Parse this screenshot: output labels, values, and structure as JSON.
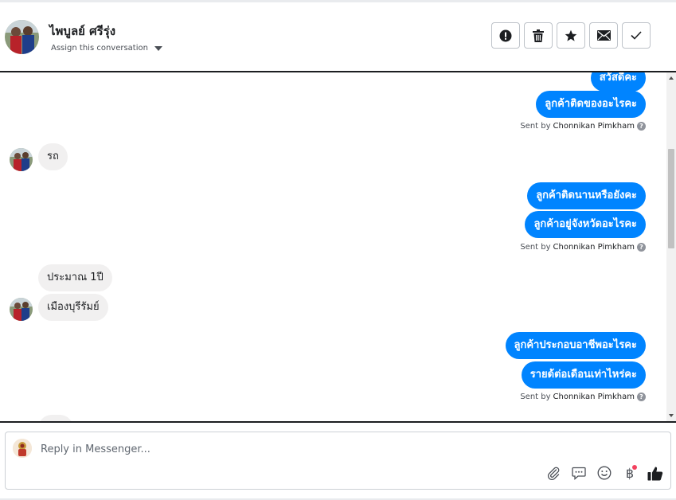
{
  "header": {
    "contact_name": "ไพบูลย์ ศรีรุ่ง",
    "assign_label": "Assign this conversation",
    "actions": [
      {
        "icon": "alert-icon",
        "name": "mark-spam-button"
      },
      {
        "icon": "trash-icon",
        "name": "delete-button"
      },
      {
        "icon": "star-icon",
        "name": "star-button"
      },
      {
        "icon": "envelope-icon",
        "name": "mark-unread-button"
      },
      {
        "icon": "check-icon",
        "name": "mark-done-button"
      }
    ]
  },
  "thread": {
    "messages": [
      {
        "dir": "out",
        "text": "สวัสดีคะ"
      },
      {
        "dir": "out",
        "text": "ลูกค้าติดของอะไรคะ"
      },
      {
        "dir": "sent_by",
        "prefix": "Sent by",
        "author": "Chonnikan Pimkham"
      },
      {
        "dir": "in",
        "text": "รถ"
      },
      {
        "dir": "out",
        "text": "ลูกค้าติดนานหรือยังคะ"
      },
      {
        "dir": "out",
        "text": "ลูกค้าอยู่จังหวัดอะไรคะ"
      },
      {
        "dir": "sent_by",
        "prefix": "Sent by",
        "author": "Chonnikan Pimkham"
      },
      {
        "dir": "in",
        "text": "ประมาณ 1ปี"
      },
      {
        "dir": "in",
        "text": "เมืองบุรีรัมย์"
      },
      {
        "dir": "out",
        "text": "ลูกค้าประกอบอาชีพอะไรคะ"
      },
      {
        "dir": "out",
        "text": "รายด้ต่อเดือนเท่าไหร่คะ"
      },
      {
        "dir": "sent_by",
        "prefix": "Sent by",
        "author": "Chonnikan Pimkham"
      }
    ]
  },
  "composer": {
    "placeholder": "Reply in Messenger...",
    "tools": [
      "paperclip-icon",
      "saved-reply-icon",
      "emoji-icon",
      "baht-payment-icon",
      "thumbs-up-icon"
    ],
    "baht_symbol": "฿"
  },
  "colors": {
    "outgoing_bubble": "#0084ff",
    "incoming_bubble": "#f1f0f0",
    "notification_dot": "#f3425f"
  }
}
